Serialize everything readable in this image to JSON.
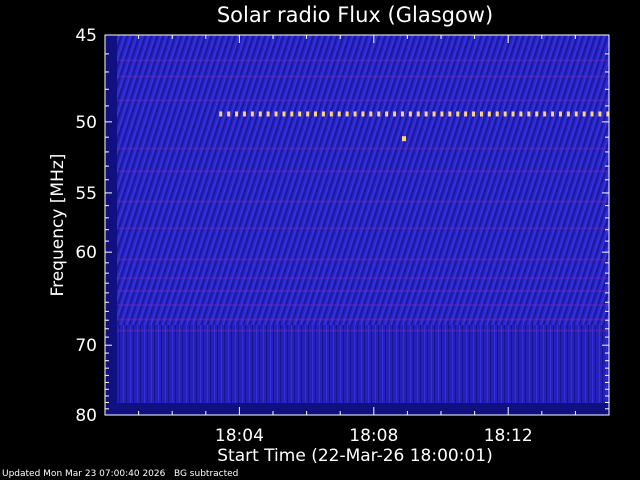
{
  "chart_data": {
    "type": "heatmap",
    "title": "Solar radio Flux (Glasgow)",
    "xlabel": "Start Time (22-Mar-26 18:00:01)",
    "ylabel": "Frequency [MHz]",
    "x_ticks": [
      "18:04",
      "18:08",
      "18:12"
    ],
    "x_tick_minutes": [
      4,
      8,
      12
    ],
    "xlim_minutes": [
      0,
      15
    ],
    "y_ticks": [
      45,
      50,
      55,
      60,
      70,
      80
    ],
    "ylim": [
      45,
      80
    ],
    "y_scale": "reciprocal",
    "grid": false,
    "colors": {
      "background": "#000000",
      "field": "#2a26c8",
      "field_dark": "#101080",
      "stripe": "#8a2ab0",
      "burst": "#ffd37a"
    },
    "features": [
      {
        "kind": "interference-line",
        "freq_mhz": 49.5,
        "from_minute": 3.4,
        "to_minute": 15
      },
      {
        "kind": "spot",
        "freq_mhz": 51.1,
        "minute": 8.9
      }
    ]
  },
  "footer": {
    "updated": "Updated Mon Mar 23 07:00:40 2026",
    "note": "BG subtracted"
  }
}
